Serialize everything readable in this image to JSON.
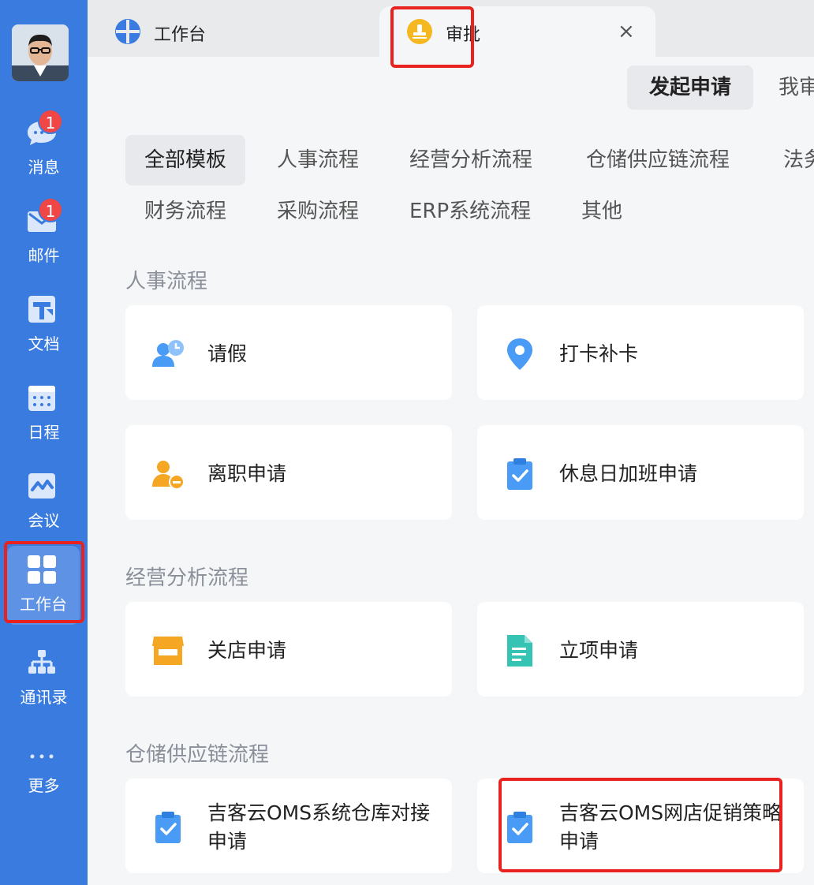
{
  "sidebar": {
    "items": [
      {
        "label": "消息",
        "icon": "chat-bubble-icon",
        "badge": "1"
      },
      {
        "label": "邮件",
        "icon": "mail-icon",
        "badge": "1"
      },
      {
        "label": "文档",
        "icon": "document-icon"
      },
      {
        "label": "日程",
        "icon": "calendar-icon"
      },
      {
        "label": "会议",
        "icon": "meeting-icon"
      },
      {
        "label": "工作台",
        "icon": "grid-icon",
        "active": true
      },
      {
        "label": "通讯录",
        "icon": "org-chart-icon"
      },
      {
        "label": "更多",
        "icon": "more-dots-icon"
      }
    ]
  },
  "tabs": [
    {
      "label": "工作台",
      "icon": "workbench-icon"
    },
    {
      "label": "审批",
      "icon": "approval-stamp-icon",
      "active": true
    }
  ],
  "segments": {
    "primary": "发起申请",
    "secondary": "我审"
  },
  "filters": {
    "row1": [
      "全部模板",
      "人事流程",
      "经营分析流程",
      "仓储供应链流程",
      "法务"
    ],
    "row2": [
      "财务流程",
      "采购流程",
      "ERP系统流程",
      "其他"
    ]
  },
  "sections": [
    {
      "title": "人事流程",
      "cards": [
        {
          "label": "请假",
          "icon": "leave-user-clock-icon"
        },
        {
          "label": "打卡补卡",
          "icon": "location-pin-icon"
        },
        {
          "label": "离职申请",
          "icon": "resign-user-icon"
        },
        {
          "label": "休息日加班申请",
          "icon": "clipboard-check-icon"
        }
      ]
    },
    {
      "title": "经营分析流程",
      "cards": [
        {
          "label": "关店申请",
          "icon": "shop-icon"
        },
        {
          "label": "立项申请",
          "icon": "file-doc-icon"
        }
      ]
    },
    {
      "title": "仓储供应链流程",
      "cards": [
        {
          "label": "吉客云OMS系统仓库对接申请",
          "icon": "clipboard-check-icon"
        },
        {
          "label": "吉客云OMS网店促销策略申请",
          "icon": "clipboard-check-icon"
        }
      ]
    }
  ],
  "colors": {
    "sidebar": "#3a7be0",
    "highlight": "#e8221e",
    "icon_blue": "#4a9bf5",
    "icon_orange": "#f5a623",
    "icon_teal": "#35c3b4"
  }
}
